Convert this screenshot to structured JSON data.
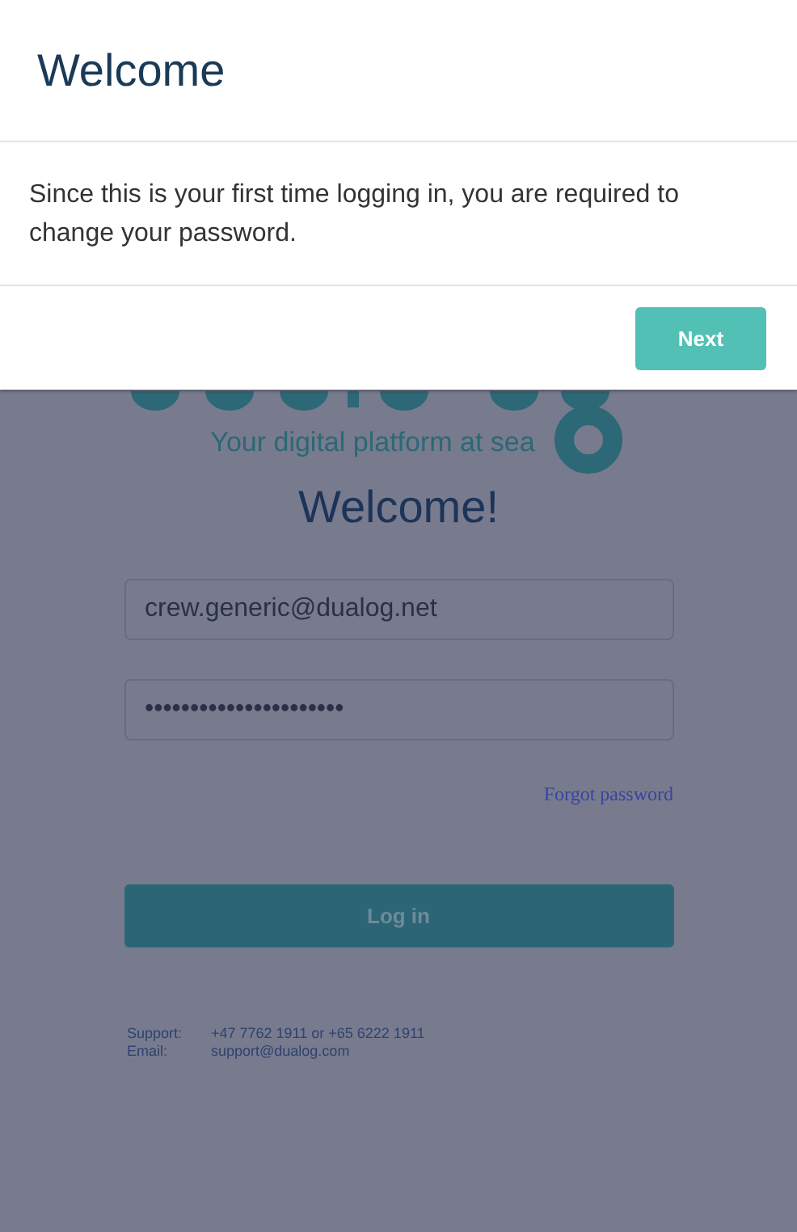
{
  "dialog": {
    "title": "Welcome",
    "message": "Since this is your first time logging in, you are required to change your password.",
    "buttons": [
      "Next"
    ]
  },
  "login": {
    "tagline": "Your digital platform at sea",
    "heading": "Welcome!",
    "email": {
      "value": "crew.generic@dualog.net"
    },
    "password": {
      "value": "••••••••••••••••••••••"
    },
    "forgot_link": "Forgot password",
    "login_button": "Log in",
    "contacts": [
      {
        "label": "Support:",
        "value": "+47 7762 1911 or +65 6222 1911"
      },
      {
        "label": "Email:",
        "value": "support@dualog.com"
      }
    ]
  }
}
